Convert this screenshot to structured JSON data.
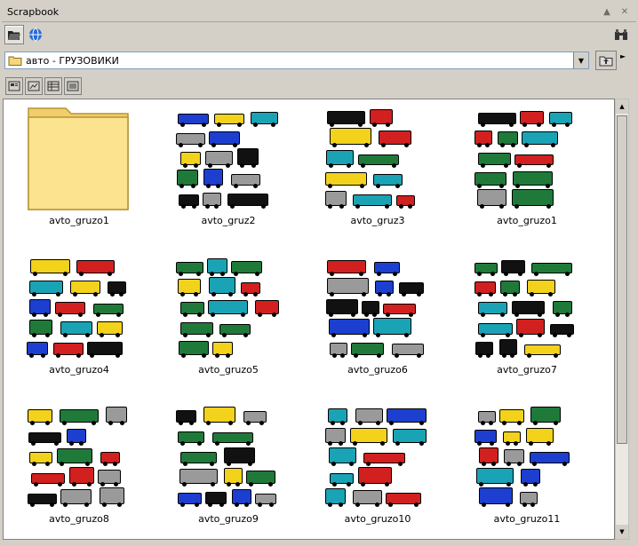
{
  "window": {
    "title": "Scrapbook"
  },
  "address": {
    "value": "авто - ГРУЗОВИКИ"
  },
  "items": [
    {
      "label": "avto_gruzo1",
      "kind": "folder"
    },
    {
      "label": "avto_gruz2",
      "kind": "clipart"
    },
    {
      "label": "avto_gruz3",
      "kind": "clipart"
    },
    {
      "label": "avto_gruzo1",
      "kind": "clipart"
    },
    {
      "label": "avto_gruzo4",
      "kind": "clipart"
    },
    {
      "label": "avto_gruzo5",
      "kind": "clipart"
    },
    {
      "label": "avto_gruzo6",
      "kind": "clipart"
    },
    {
      "label": "avto_gruzo7",
      "kind": "clipart"
    },
    {
      "label": "avto_gruzo8",
      "kind": "clipart"
    },
    {
      "label": "avto_gruzo9",
      "kind": "clipart"
    },
    {
      "label": "avto_gruzo10",
      "kind": "clipart"
    },
    {
      "label": "avto_gruzo11",
      "kind": "clipart"
    }
  ],
  "colors": {
    "folder": "#f9dc80",
    "truck_red": "#d22020",
    "truck_blue": "#1d3fd0",
    "truck_green": "#1f7a3a",
    "truck_black": "#111111",
    "truck_gray": "#9a9a9a",
    "truck_teal": "#1aa3b5",
    "truck_yellow": "#f2d21b"
  }
}
